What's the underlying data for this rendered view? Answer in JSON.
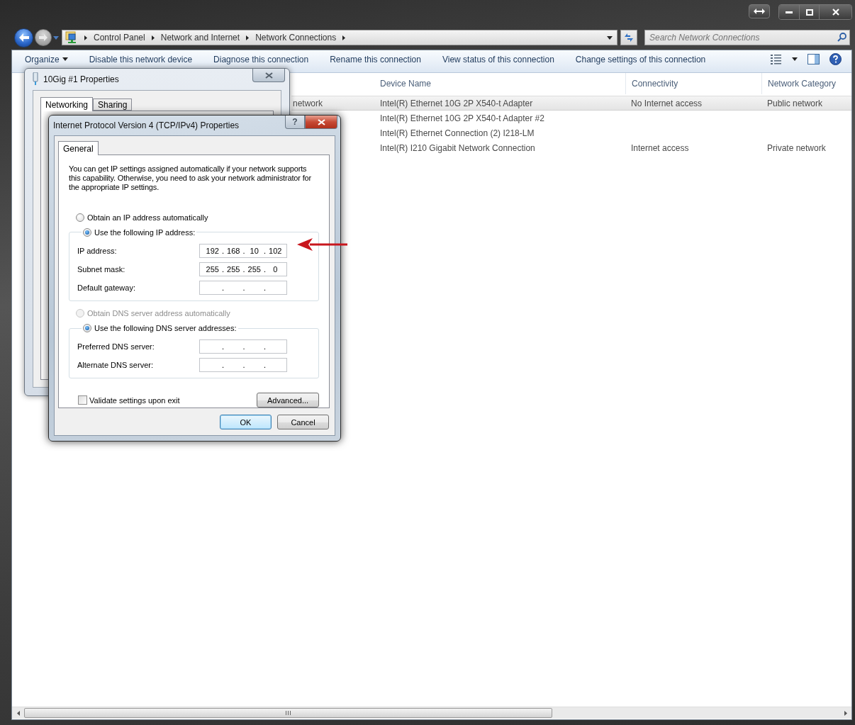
{
  "address_bar": {
    "breadcrumbs": [
      "Control Panel",
      "Network and Internet",
      "Network Connections"
    ]
  },
  "search": {
    "placeholder": "Search Network Connections"
  },
  "toolbar": {
    "items": [
      {
        "label": "Organize",
        "kind": "menu"
      },
      {
        "label": "Disable this network device",
        "kind": "command"
      },
      {
        "label": "Diagnose this connection",
        "kind": "command"
      },
      {
        "label": "Rename this connection",
        "kind": "command"
      },
      {
        "label": "View status of this connection",
        "kind": "command"
      },
      {
        "label": "Change settings of this connection",
        "kind": "command"
      }
    ]
  },
  "table": {
    "columns": [
      "Device Name",
      "Connectivity",
      "Network Category"
    ],
    "rows": [
      {
        "column_1": "network",
        "device_name": "Intel(R) Ethernet 10G 2P X540-t Adapter",
        "connectivity": "No Internet access",
        "network_category": "Public network",
        "selected": true
      },
      {
        "device_name": "Intel(R) Ethernet 10G 2P X540-t Adapter #2",
        "selected": false
      },
      {
        "device_name": "Intel(R) Ethernet Connection (2) I218-LM",
        "selected": false
      },
      {
        "device_name": "Intel(R) I210 Gigabit Network Connection",
        "connectivity": "Internet access",
        "network_category": "Private network",
        "selected": false
      }
    ]
  },
  "properties_dialog": {
    "title": "10Gig #1 Properties",
    "tabs": [
      {
        "label": "Networking",
        "selected": true
      },
      {
        "label": "Sharing",
        "selected": false
      }
    ]
  },
  "ipv4_dialog": {
    "title": "Internet Protocol Version 4 (TCP/IPv4) Properties",
    "help": "?",
    "tabs": [
      {
        "label": "General",
        "selected": true
      }
    ],
    "description": "You can get IP settings assigned automatically if your network supports this capability. Otherwise, you need to ask your network administrator for the appropriate IP settings.",
    "ip_options": [
      {
        "label": "Obtain an IP address automatically",
        "selected": false,
        "disabled": false
      },
      {
        "label": "Use the following IP address:",
        "selected": true,
        "disabled": false
      }
    ],
    "ip_fields": [
      {
        "label": "IP address:",
        "separator": ".",
        "octets": [
          "192",
          "168",
          "10",
          "102"
        ]
      },
      {
        "label": "Subnet mask:",
        "separator": ".",
        "octets": [
          "255",
          "255",
          "255",
          "0"
        ]
      },
      {
        "label": "Default gateway:",
        "separator": "."
      }
    ],
    "dns_options": [
      {
        "label": "Obtain DNS server address automatically",
        "selected": false,
        "disabled": true
      },
      {
        "label": "Use the following DNS server addresses:",
        "selected": true,
        "disabled": false
      }
    ],
    "dns_fields": [
      {
        "label": "Preferred DNS server:",
        "separator": "."
      },
      {
        "label": "Alternate DNS server:",
        "separator": "."
      }
    ],
    "validate": {
      "label": "Validate settings upon exit",
      "checked": false
    },
    "advanced_button": "Advanced...",
    "buttons": [
      {
        "label": "OK",
        "focused": true
      },
      {
        "label": "Cancel",
        "focused": false
      }
    ]
  }
}
